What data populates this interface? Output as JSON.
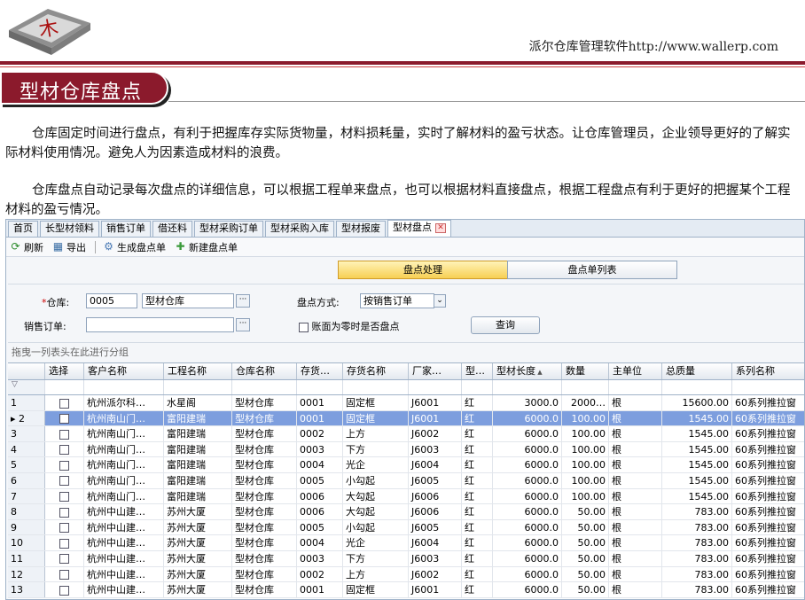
{
  "header": {
    "site_text": "派尔仓库管理软件http://www.wallerp.com",
    "page_title": "型材仓库盘点"
  },
  "paragraphs": [
    "仓库固定时间进行盘点，有利于把握库存实际货物量，材料损耗量，实时了解材料的盈亏状态。让仓库管理员，企业领导更好的了解实际材料使用情况。避免人为因素造成材料的浪费。",
    "仓库盘点自动记录每次盘点的详细信息，可以根据工程单来盘点，也可以根据材料直接盘点，根据工程盘点有利于更好的把握某个工程材料的盈亏情况。"
  ],
  "app": {
    "tabs": [
      "首页",
      "长型材领料",
      "销售订单",
      "借还料",
      "型材采购订单",
      "型材采购入库",
      "型材报废",
      "型材盘点"
    ],
    "active_tab": 7,
    "toolbar": {
      "refresh": "刷新",
      "export": "导出",
      "generate": "生成盘点单",
      "new": "新建盘点单"
    },
    "segments": {
      "active": "盘点处理",
      "other": "盘点单列表"
    },
    "form": {
      "warehouse_label": "仓库:",
      "warehouse_code": "0005",
      "warehouse_name": "型材仓库",
      "order_label": "销售订单:",
      "order_value": "",
      "method_label": "盘点方式:",
      "method_value": "按销售订单",
      "zero_label": "账面为零时是否盘点",
      "query_button": "查询"
    },
    "group_hint": "拖曳一列表头在此进行分组",
    "columns": [
      "",
      "选择",
      "客户名称",
      "工程名称",
      "仓库名称",
      "存货…",
      "存货名称",
      "厂家…",
      "型…",
      "型材长度",
      "数量",
      "主单位",
      "总质量",
      "系列名称"
    ],
    "sort_column": 9,
    "rows": [
      [
        "1",
        "杭州派尔科…",
        "水星阁",
        "型材仓库",
        "0001",
        "固定框",
        "J6001",
        "红",
        "3000.0",
        "2000…",
        "根",
        "15600.00",
        "60系列推拉窗"
      ],
      [
        "2",
        "杭州南山门…",
        "富阳建瑞",
        "型材仓库",
        "0001",
        "固定框",
        "J6001",
        "红",
        "6000.0",
        "100.00",
        "根",
        "1545.00",
        "60系列推拉窗"
      ],
      [
        "3",
        "杭州南山门…",
        "富阳建瑞",
        "型材仓库",
        "0002",
        "上方",
        "J6002",
        "红",
        "6000.0",
        "100.00",
        "根",
        "1545.00",
        "60系列推拉窗"
      ],
      [
        "4",
        "杭州南山门…",
        "富阳建瑞",
        "型材仓库",
        "0003",
        "下方",
        "J6003",
        "红",
        "6000.0",
        "100.00",
        "根",
        "1545.00",
        "60系列推拉窗"
      ],
      [
        "5",
        "杭州南山门…",
        "富阳建瑞",
        "型材仓库",
        "0004",
        "光企",
        "J6004",
        "红",
        "6000.0",
        "100.00",
        "根",
        "1545.00",
        "60系列推拉窗"
      ],
      [
        "6",
        "杭州南山门…",
        "富阳建瑞",
        "型材仓库",
        "0005",
        "小勾起",
        "J6005",
        "红",
        "6000.0",
        "100.00",
        "根",
        "1545.00",
        "60系列推拉窗"
      ],
      [
        "7",
        "杭州南山门…",
        "富阳建瑞",
        "型材仓库",
        "0006",
        "大勾起",
        "J6006",
        "红",
        "6000.0",
        "100.00",
        "根",
        "1545.00",
        "60系列推拉窗"
      ],
      [
        "8",
        "杭州中山建…",
        "苏州大厦",
        "型材仓库",
        "0006",
        "大勾起",
        "J6006",
        "红",
        "6000.0",
        "50.00",
        "根",
        "783.00",
        "60系列推拉窗"
      ],
      [
        "9",
        "杭州中山建…",
        "苏州大厦",
        "型材仓库",
        "0005",
        "小勾起",
        "J6005",
        "红",
        "6000.0",
        "50.00",
        "根",
        "783.00",
        "60系列推拉窗"
      ],
      [
        "10",
        "杭州中山建…",
        "苏州大厦",
        "型材仓库",
        "0004",
        "光企",
        "J6004",
        "红",
        "6000.0",
        "50.00",
        "根",
        "783.00",
        "60系列推拉窗"
      ],
      [
        "11",
        "杭州中山建…",
        "苏州大厦",
        "型材仓库",
        "0003",
        "下方",
        "J6003",
        "红",
        "6000.0",
        "50.00",
        "根",
        "783.00",
        "60系列推拉窗"
      ],
      [
        "12",
        "杭州中山建…",
        "苏州大厦",
        "型材仓库",
        "0002",
        "上方",
        "J6002",
        "红",
        "6000.0",
        "50.00",
        "根",
        "783.00",
        "60系列推拉窗"
      ],
      [
        "13",
        "杭州中山建…",
        "苏州大厦",
        "型材仓库",
        "0001",
        "固定框",
        "J6001",
        "红",
        "6000.0",
        "50.00",
        "根",
        "783.00",
        "60系列推拉窗"
      ]
    ],
    "selected_row": 1
  }
}
